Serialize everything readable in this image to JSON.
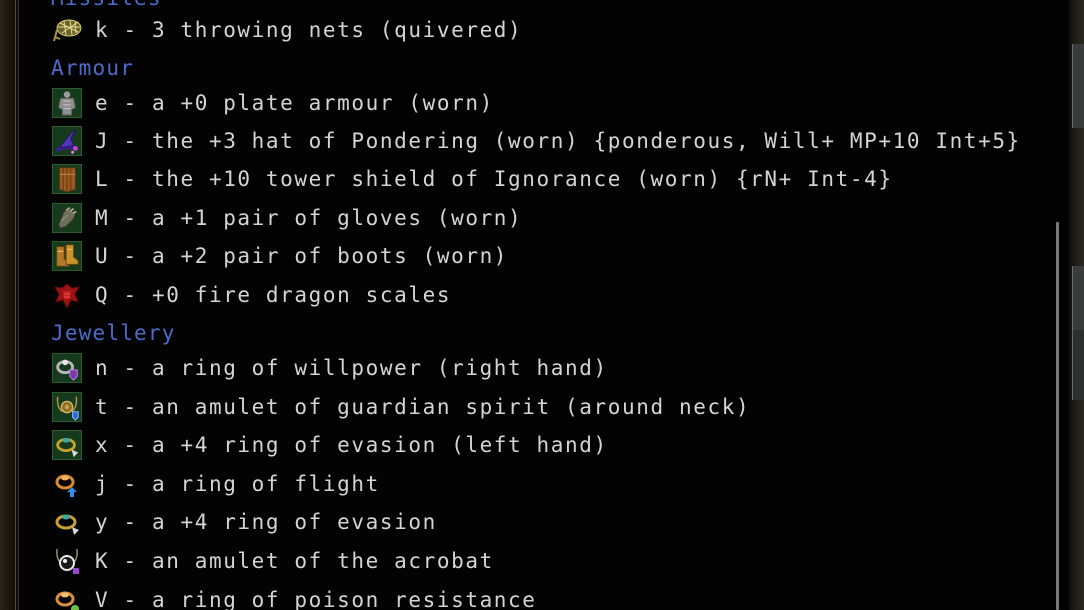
{
  "sections": {
    "missiles": {
      "heading": "Missiles"
    },
    "armour": {
      "heading": "Armour"
    },
    "jewellery": {
      "heading": "Jewellery"
    }
  },
  "items": [
    {
      "letter": "k",
      "text": "k - 3 throwing nets (quivered)",
      "icon": "throwing-net-icon",
      "equipped_bg": false
    },
    {
      "letter": "e",
      "text": "e - a +0 plate armour (worn)",
      "icon": "plate-armour-icon",
      "equipped_bg": true
    },
    {
      "letter": "J",
      "text": "J - the +3 hat of Pondering (worn) {ponderous, Will+ MP+10 Int+5}",
      "icon": "wizard-hat-icon",
      "equipped_bg": true
    },
    {
      "letter": "L",
      "text": "L - the +10 tower shield of Ignorance (worn) {rN+ Int-4}",
      "icon": "tower-shield-icon",
      "equipped_bg": true
    },
    {
      "letter": "M",
      "text": "M - a +1 pair of gloves (worn)",
      "icon": "gloves-icon",
      "equipped_bg": true
    },
    {
      "letter": "U",
      "text": "U - a +2 pair of boots (worn)",
      "icon": "boots-icon",
      "equipped_bg": true
    },
    {
      "letter": "Q",
      "text": "Q - +0 fire dragon scales",
      "icon": "fire-dragon-scales-icon",
      "equipped_bg": false
    },
    {
      "letter": "n",
      "text": "n - a ring of willpower (right hand)",
      "icon": "ring-willpower-icon",
      "equipped_bg": true
    },
    {
      "letter": "t",
      "text": "t - an amulet of guardian spirit (around neck)",
      "icon": "amulet-guardian-spirit-icon",
      "equipped_bg": true
    },
    {
      "letter": "x",
      "text": "x - a +4 ring of evasion (left hand)",
      "icon": "ring-evasion-icon",
      "equipped_bg": true
    },
    {
      "letter": "j",
      "text": "j - a ring of flight",
      "icon": "ring-flight-icon",
      "equipped_bg": false
    },
    {
      "letter": "y",
      "text": "y - a +4 ring of evasion",
      "icon": "ring-evasion-icon",
      "equipped_bg": false
    },
    {
      "letter": "K",
      "text": "K - an amulet of the acrobat",
      "icon": "amulet-acrobat-icon",
      "equipped_bg": false
    },
    {
      "letter": "V",
      "text": "V - a ring of poison resistance",
      "icon": "ring-poison-resistance-icon",
      "equipped_bg": false
    }
  ],
  "colors": {
    "item_text": "#d4d4d4",
    "section_heading": "#4c6bc9",
    "background": "#030303",
    "equipped_icon_bg": "#163a1c"
  }
}
